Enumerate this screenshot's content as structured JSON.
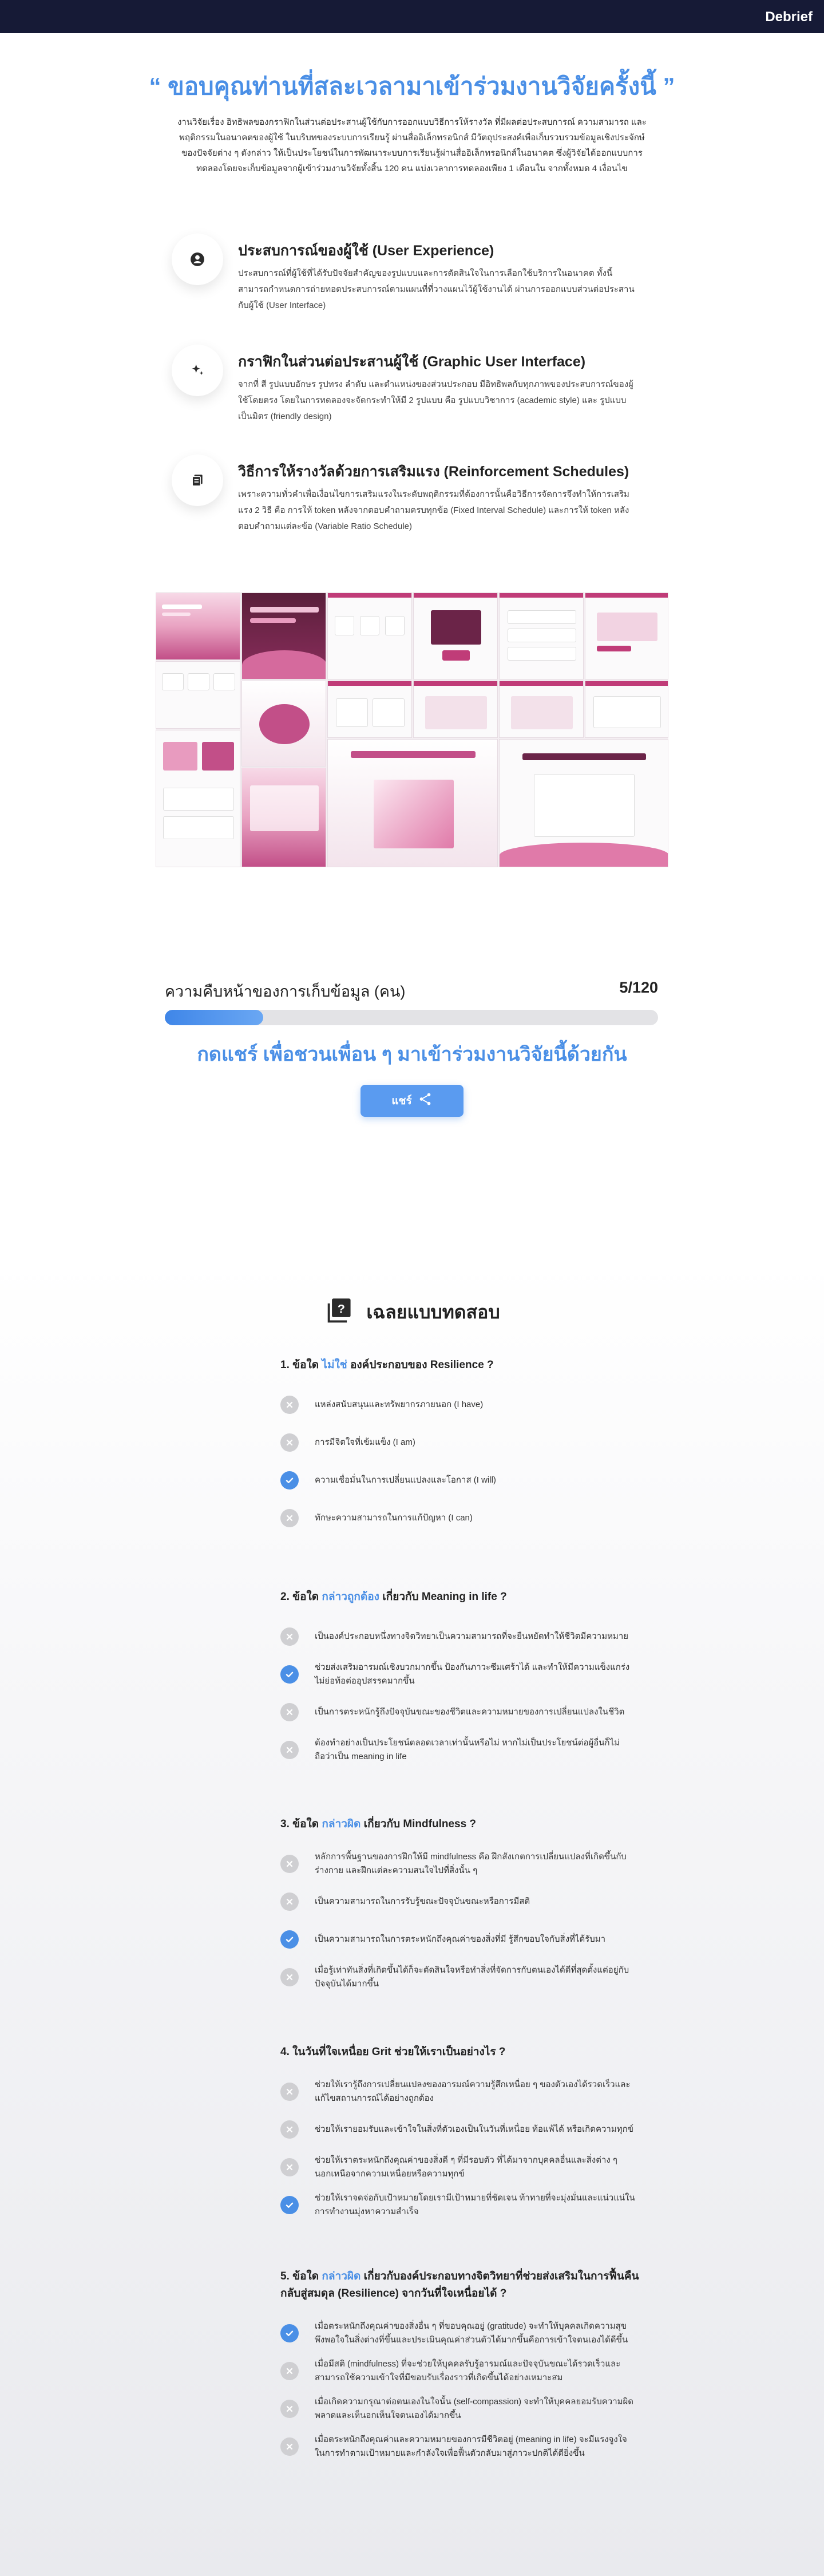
{
  "header": {
    "brand": "Debrief"
  },
  "thanks": {
    "title": "“ ขอบคุณท่านที่สละเวลามาเข้าร่วมงานวิจัยครั้งนี้ ”",
    "intro": "งานวิจัยเรื่อง อิทธิพลของกราฟิกในส่วนต่อประสานผู้ใช้กับการออกแบบวิธีการให้รางวัล ที่มีผลต่อประสบการณ์ ความสามารถ และพฤติกรรมในอนาคตของผู้ใช้ ในบริบทของระบบการเรียนรู้ ผ่านสื่ออิเล็กทรอนิกส์ มีวัตถุประสงค์เพื่อเก็บรวบรวมข้อมูลเชิงประจักษ์ของปัจจัยต่าง ๆ ดังกล่าว ให้เป็นประโยชน์ในการพัฒนาระบบการเรียนรู้ผ่านสื่ออิเล็กทรอนิกส์ในอนาคต ซึ่งผู้วิจัยได้ออกแบบการทดลองโดยจะเก็บข้อมูลจากผู้เข้าร่วมงานวิจัยทั้งสิ้น 120 คน แบ่งเวลาการทดลองเพียง 1 เดือนใน จากทั้งหมด 4 เงื่อนไข"
  },
  "features": [
    {
      "icon": "user-experience-icon",
      "title": "ประสบการณ์ของผู้ใช้ (User Experience)",
      "desc": "ประสบการณ์ที่ผู้ใช้ที่ได้รับปัจจัยสำคัญของรูปแบบและการตัดสินใจในการเลือกใช้บริการในอนาคต ทั้งนี้สามารถกำหนดการถ่ายทอดประสบการณ์ตามแผนที่ที่วางแผนไว้ผู้ใช้งานได้ ผ่านการออกแบบส่วนต่อประสานกับผู้ใช้ (User Interface)"
    },
    {
      "icon": "sparkle-icon",
      "title": "กราฟิกในส่วนต่อประสานผู้ใช้ (Graphic User Interface)",
      "desc": "จากที่ สี รูปแบบอักษร รูปทรง ลำดับ และตำแหน่งของส่วนประกอบ มีอิทธิพลกับทุกภาพของประสบการณ์ของผู้ใช้โดยตรง โดยในการทดลองจะจัดกระทำให้มี 2 รูปแบบ คือ รูปแบบวิชาการ (academic style) และ รูปแบบเป็นมิตร (friendly design)"
    },
    {
      "icon": "reward-icon",
      "title": "วิธีการให้รางวัลด้วยการเสริมแรง (Reinforcement Schedules)",
      "desc": "เพราะความทั่วคำเพื่อเงื่อนไขการเสริมแรงในระดับพฤติกรรมที่ต้องการนั้นคือวิธีการจัดการจึงทำให้การเสริมแรง 2 วิธี คือ การให้ token หลังจากตอบคำถามครบทุกข้อ (Fixed Interval Schedule) และการให้ token หลังตอบคำถามแต่ละข้อ (Variable Ratio Schedule)"
    }
  ],
  "progress": {
    "label": "ความคืบหน้าของการเก็บข้อมูล (คน)",
    "current": 5,
    "total": 120,
    "display": "5/120",
    "fraction": 0.2
  },
  "share": {
    "title": "กดแชร์ เพื่อชวนเพื่อน ๆ มาเข้าร่วมงานวิจัยนี้ด้วยกัน",
    "button_label": "แชร์"
  },
  "quiz": {
    "title": "เฉลยแบบทดสอบ",
    "questions": [
      {
        "prefix": "1. ข้อใด ",
        "highlight": "ไม่ใช่",
        "suffix": " องค์ประกอบของ Resilience ?",
        "options": [
          {
            "text": "แหล่งสนับสนุนและทรัพยากรภายนอก (I have)",
            "correct": false
          },
          {
            "text": "การมีจิตใจที่เข้มแข็ง (I am)",
            "correct": false
          },
          {
            "text": "ความเชื่อมั่นในการเปลี่ยนแปลงและโอกาส (I will)",
            "correct": true
          },
          {
            "text": "ทักษะความสามารถในการแก้ปัญหา (I can)",
            "correct": false
          }
        ]
      },
      {
        "prefix": "2. ข้อใด ",
        "highlight": "กล่าวถูกต้อง",
        "suffix": " เกี่ยวกับ Meaning in life ?",
        "options": [
          {
            "text": "เป็นองค์ประกอบหนึ่งทางจิตวิทยาเป็นความสามารถที่จะยืนหยัดทำให้ชีวิตมีความหมาย",
            "correct": false
          },
          {
            "text": "ช่วยส่งเสริมอารมณ์เชิงบวกมากขึ้น ป้องกันภาวะซึมเศร้าได้ และทำให้มีความแข็งแกร่งไม่ย่อท้อต่ออุปสรรคมากขึ้น",
            "correct": true
          },
          {
            "text": "เป็นการตระหนักรู้ถึงปัจจุบันขณะของชีวิตและความหมายของการเปลี่ยนแปลงในชีวิต",
            "correct": false
          },
          {
            "text": "ต้องทำอย่างเป็นประโยชน์ตลอดเวลาเท่านั้นหรือไม่ หากไม่เป็นประโยชน์ต่อผู้อื่นก็ไม่ถือว่าเป็น meaning in life",
            "correct": false
          }
        ]
      },
      {
        "prefix": "3. ข้อใด ",
        "highlight": "กล่าวผิด",
        "suffix": " เกี่ยวกับ Mindfulness ?",
        "options": [
          {
            "text": "หลักการพื้นฐานของการฝึกให้มี mindfulness คือ ฝึกสังเกตการเปลี่ยนแปลงที่เกิดขึ้นกับร่างกาย และฝึกแต่ละความสนใจไปที่สิ่งนั้น ๆ",
            "correct": false
          },
          {
            "text": "เป็นความสามารถในการรับรู้ขณะปัจจุบันขณะหรือการมีสติ",
            "correct": false
          },
          {
            "text": "เป็นความสามารถในการตระหนักถึงคุณค่าของสิ่งที่มี รู้สึกขอบใจกับสิ่งที่ได้รับมา",
            "correct": true
          },
          {
            "text": "เมื่อรู้เท่าทันสิ่งที่เกิดขึ้นได้ก็จะตัดสินใจหรือทำสิ่งที่จัดการกับตนเองได้ดีที่สุดตั้งแต่อยู่กับปัจจุบันได้มากขึ้น",
            "correct": false
          }
        ]
      },
      {
        "prefix": "4. ในวันที่ใจเหนื่อย Grit ช่วยให้เราเป็นอย่างไร ?",
        "highlight": "",
        "suffix": "",
        "options": [
          {
            "text": "ช่วยให้เรารู้ถึงการเปลี่ยนแปลงของอารมณ์ความรู้สึกเหนื่อย ๆ ของตัวเองได้รวดเร็วและแก้ไขสถานการณ์ได้อย่างถูกต้อง",
            "correct": false
          },
          {
            "text": "ช่วยให้เรายอมรับและเข้าใจในสิ่งที่ตัวเองเป็นในวันที่เหนื่อย ท้อแพ้ได้ หรือเกิดความทุกข์",
            "correct": false
          },
          {
            "text": "ช่วยให้เราตระหนักถึงคุณค่าของสิ่งดี ๆ ที่มีรอบตัว ที่ได้มาจากบุคคลอื่นและสิ่งต่าง ๆ นอกเหนือจากความเหนื่อยหรือความทุกข์",
            "correct": false
          },
          {
            "text": "ช่วยให้เราจดจ่อกับเป้าหมายโดยเรามีเป้าหมายที่ชัดเจน ท้าทายที่จะมุ่งมั่นและแน่วแน่ในการทำงานมุ่งหาความสำเร็จ",
            "correct": true
          }
        ]
      },
      {
        "prefix": "5. ข้อใด ",
        "highlight": "กล่าวผิด",
        "suffix": " เกี่ยวกับองค์ประกอบทางจิตวิทยาที่ช่วยส่งเสริมในการฟื้นคืนกลับสู่สมดุล (Resilience) จากวันที่ใจเหนื่อยได้ ?",
        "options": [
          {
            "text": "เมื่อตระหนักถึงคุณค่าของสิ่งอื่น ๆ ที่ขอบคุณอยู่ (gratitude) จะทำให้บุคคลเกิดความสุขพึงพอใจในสิ่งต่างที่ขึ้นและประเมินคุณค่าส่วนตัวได้มากขึ้นคือการเข้าใจตนเองได้ดีขึ้น",
            "correct": true
          },
          {
            "text": "เมื่อมีสติ (mindfulness) ที่จะช่วยให้บุคคลรับรู้อารมณ์และปัจจุบันขณะได้รวดเร็วและสามารถใช้ความเข้าใจที่มีขอบรับเรื่องราวที่เกิดขึ้นได้อย่างเหมาะสม",
            "correct": false
          },
          {
            "text": "เมื่อเกิดความกรุณาต่อตนเองในใจนั้น (self-compassion) จะทำให้บุคคลยอมรับความผิดพลาดและเห็นอกเห็นใจตนเองได้มากขึ้น",
            "correct": false
          },
          {
            "text": "เมื่อตระหนักถึงคุณค่าและความหมายของการมีชีวิตอยู่ (meaning in life) จะมีแรงจูงใจในการทำตามเป้าหมายและกำลังใจเพื่อฟื้นตัวกลับมาสู่ภาวะปกติได้ดียิ่งขึ้น",
            "correct": false
          }
        ]
      }
    ]
  },
  "colors": {
    "header": "#161a36",
    "accent": "#4a8fe6",
    "correct": "#4a8fe6",
    "wrong": "#cfcfd2",
    "collage_pink": "#c24f88"
  }
}
